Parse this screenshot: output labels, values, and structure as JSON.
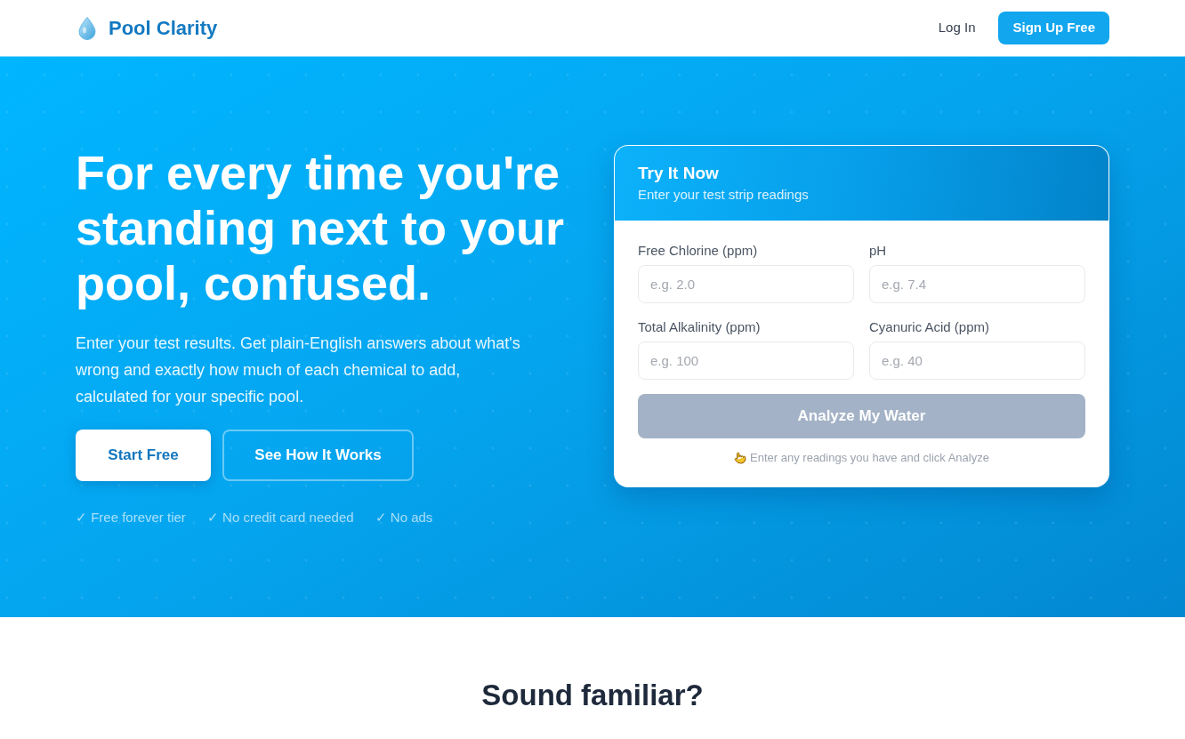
{
  "header": {
    "brand": "Pool Clarity",
    "nav": [
      {
        "label": "Log In",
        "kind": "link"
      },
      {
        "label": "Sign Up Free",
        "kind": "button"
      }
    ]
  },
  "hero": {
    "headline": "For every time you're standing next to your pool, confused.",
    "description": "Enter your test results. Get plain-English answers about what's wrong and exactly how much of each chemical to add, calculated for your specific pool.",
    "buttons": [
      {
        "label": "Start Free",
        "kind": "primary"
      },
      {
        "label": "See How It Works",
        "kind": "outline"
      }
    ],
    "perks": [
      "✓ Free forever tier",
      "✓ No credit card needed",
      "✓ No ads"
    ]
  },
  "try_card": {
    "title": "Try It Now",
    "subtitle": "Enter your test strip readings",
    "fields": [
      {
        "label": "Free Chlorine (ppm)",
        "placeholder": "e.g. 2.0"
      },
      {
        "label": "pH",
        "placeholder": "e.g. 7.4"
      },
      {
        "label": "Total Alkalinity (ppm)",
        "placeholder": "e.g. 100"
      },
      {
        "label": "Cyanuric Acid (ppm)",
        "placeholder": "e.g. 40"
      }
    ],
    "submit": {
      "label": "Analyze My Water",
      "disabled": true
    },
    "hint": "Enter any readings you have and click Analyze"
  },
  "next_section": {
    "title": "Sound familiar?"
  }
}
